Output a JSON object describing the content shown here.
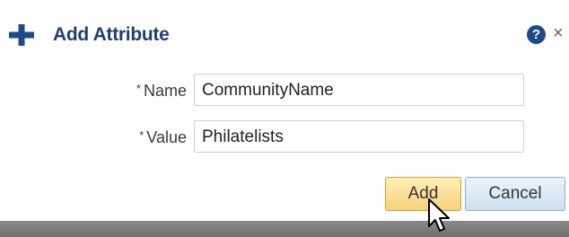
{
  "dialog": {
    "title": "Add Attribute",
    "icons": {
      "title_icon": "plus-icon",
      "help": "help-icon",
      "close": "close-icon",
      "pointer": "cursor-icon"
    },
    "help_glyph": "?",
    "close_glyph": "×"
  },
  "form": {
    "required_marker": "*",
    "name": {
      "label": "Name",
      "value": "CommunityName"
    },
    "value": {
      "label": "Value",
      "value": "Philatelists"
    }
  },
  "buttons": {
    "add_label": "Add",
    "cancel_label": "Cancel"
  },
  "colors": {
    "title": "#1f3f6e",
    "add_button": "#f7d27a",
    "cancel_button": "#cfe0ef",
    "help_icon": "#1c4a8a"
  }
}
